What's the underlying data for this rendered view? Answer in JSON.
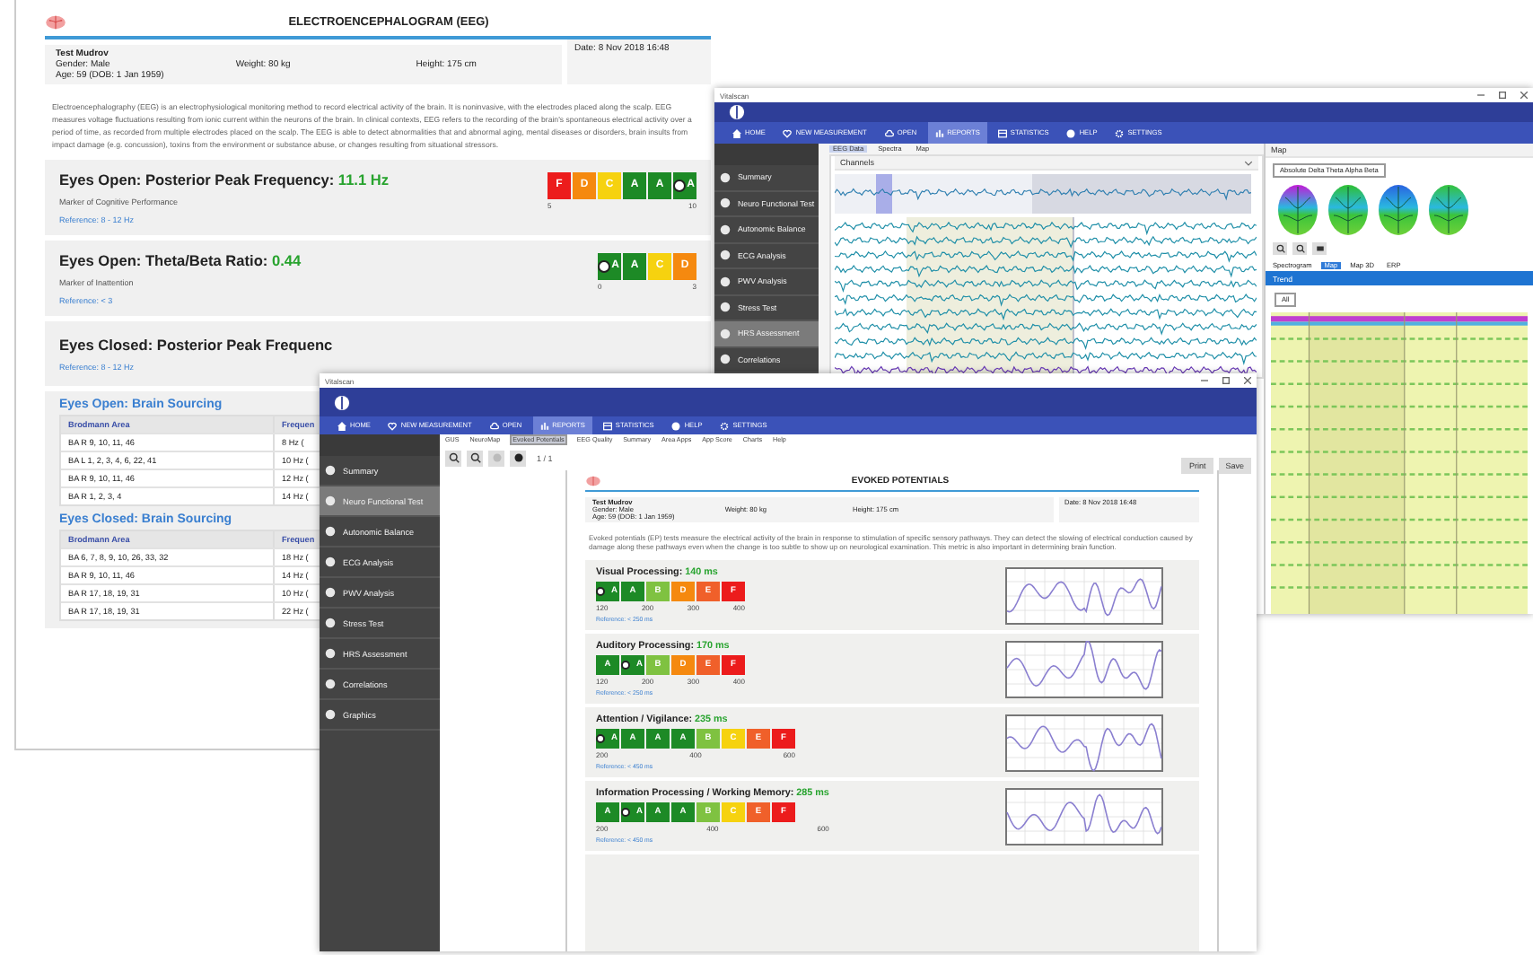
{
  "report": {
    "title": "ELECTROENCEPHALOGRAM (EEG)",
    "patient": {
      "name": "Test Mudrov",
      "gender": "Gender: Male",
      "age": "Age: 59  (DOB: 1 Jan 1959)",
      "weight": "Weight: 80 kg",
      "height": "Height: 175 cm",
      "date": "Date: 8 Nov 2018 16:48"
    },
    "description": "Electroencephalography (EEG) is an electrophysiological monitoring method to record electrical activity of the brain. It is noninvasive, with the electrodes placed along the scalp. EEG measures voltage fluctuations resulting from ionic current within the neurons of the brain. In clinical contexts, EEG refers to the recording of the brain's spontaneous electrical activity over a period of time, as recorded from multiple electrodes placed on the scalp. The EEG is able to detect abnormalities that and abnormal aging, mental diseases or disorders, brain insults from impact damage (e.g. concussion), toxins from the environment or substance abuse, or changes resulting from situational stressors.",
    "metrics": [
      {
        "title": "Eyes Open: Posterior Peak Frequency:",
        "value": "11.1 Hz",
        "marker": "Marker of Cognitive Performance",
        "reference": "Reference: 8 - 12 Hz",
        "bar": [
          {
            "grade": "F",
            "marked": false
          },
          {
            "grade": "D",
            "marked": false
          },
          {
            "grade": "C",
            "marked": false
          },
          {
            "grade": "A",
            "marked": false
          },
          {
            "grade": "A",
            "marked": false
          },
          {
            "grade": "A",
            "marked": true
          }
        ],
        "ticks": [
          "5",
          "10"
        ]
      },
      {
        "title": "Eyes Open: Theta/Beta Ratio:",
        "value": "0.44",
        "marker": "Marker of Inattention",
        "reference": "Reference: < 3",
        "bar": [
          {
            "grade": "A",
            "marked": true
          },
          {
            "grade": "A",
            "marked": false
          },
          {
            "grade": "C",
            "marked": false
          },
          {
            "grade": "D",
            "marked": false
          }
        ],
        "ticks": [
          "0",
          "3"
        ]
      }
    ],
    "closed_metric": {
      "title": "Eyes Closed: Posterior Peak Frequenc",
      "reference": "Reference: 8 - 12 Hz"
    },
    "sourcing": [
      {
        "title": "Eyes Open: Brain Sourcing",
        "columns": [
          "Brodmann Area",
          "Frequen"
        ],
        "rows": [
          [
            "BA R 9, 10, 11, 46",
            "8 Hz ("
          ],
          [
            "BA L 1, 2, 3, 4, 6, 22, 41",
            "10 Hz ("
          ],
          [
            "BA R 9, 10, 11, 46",
            "12 Hz ("
          ],
          [
            "BA R 1, 2, 3, 4",
            "14 Hz ("
          ]
        ]
      },
      {
        "title": "Eyes Closed: Brain Sourcing",
        "columns": [
          "Brodmann Area",
          "Frequen"
        ],
        "rows": [
          [
            "BA 6, 7, 8, 9, 10, 26, 33, 32",
            "18 Hz ("
          ],
          [
            "BA R 9, 10, 11, 46",
            "14 Hz ("
          ],
          [
            "BA R 17, 18, 19, 31",
            "10 Hz ("
          ],
          [
            "BA R 17, 18, 19, 31",
            "22 Hz ("
          ]
        ]
      }
    ]
  },
  "eeg_window": {
    "title": "Vitalscan",
    "nav": [
      {
        "label": "HOME",
        "selected": false
      },
      {
        "label": "NEW MEASUREMENT",
        "selected": false
      },
      {
        "label": "OPEN",
        "selected": false
      },
      {
        "label": "REPORTS",
        "selected": true
      },
      {
        "label": "STATISTICS",
        "selected": false
      },
      {
        "label": "HELP",
        "selected": false
      },
      {
        "label": "SETTINGS",
        "selected": false
      }
    ],
    "sidebar": [
      {
        "label": "Summary",
        "selected": false
      },
      {
        "label": "Neuro Functional Test",
        "selected": false
      },
      {
        "label": "Autonomic Balance",
        "selected": false
      },
      {
        "label": "ECG Analysis",
        "selected": false
      },
      {
        "label": "PWV Analysis",
        "selected": false
      },
      {
        "label": "Stress Test",
        "selected": false
      },
      {
        "label": "HRS Assessment",
        "selected": true
      },
      {
        "label": "Correlations",
        "selected": false
      }
    ],
    "tabs": [
      {
        "label": "EEG Data",
        "selected": true
      },
      {
        "label": "Spectra",
        "selected": false
      },
      {
        "label": "Map",
        "selected": false
      }
    ],
    "channels_title": "Channels",
    "map": {
      "title": "Map",
      "dropdown": "Absolute Delta Theta Alpha Beta",
      "tabs": [
        {
          "label": "Spectrogram",
          "selected": false
        },
        {
          "label": "Map",
          "selected": true
        },
        {
          "label": "Map 3D",
          "selected": false
        },
        {
          "label": "ERP",
          "selected": false
        }
      ]
    },
    "trend": {
      "title": "Trend",
      "dropdown": "All"
    }
  },
  "ep_window": {
    "title": "Vitalscan",
    "nav": [
      {
        "label": "HOME",
        "selected": false
      },
      {
        "label": "NEW MEASUREMENT",
        "selected": false
      },
      {
        "label": "OPEN",
        "selected": false
      },
      {
        "label": "REPORTS",
        "selected": true
      },
      {
        "label": "STATISTICS",
        "selected": false
      },
      {
        "label": "HELP",
        "selected": false
      },
      {
        "label": "SETTINGS",
        "selected": false
      }
    ],
    "sidebar": [
      {
        "label": "Summary",
        "selected": false
      },
      {
        "label": "Neuro Functional Test",
        "selected": true
      },
      {
        "label": "Autonomic Balance",
        "selected": false
      },
      {
        "label": "ECG Analysis",
        "selected": false
      },
      {
        "label": "PWV Analysis",
        "selected": false
      },
      {
        "label": "Stress Test",
        "selected": false
      },
      {
        "label": "HRS Assessment",
        "selected": false
      },
      {
        "label": "Correlations",
        "selected": false
      },
      {
        "label": "Graphics",
        "selected": false
      }
    ],
    "report_tabs": [
      {
        "label": "GUS",
        "selected": false
      },
      {
        "label": "NeuroMap",
        "selected": false
      },
      {
        "label": "Evoked Potentials",
        "selected": true
      },
      {
        "label": "EEG Quality",
        "selected": false
      },
      {
        "label": "Summary",
        "selected": false
      },
      {
        "label": "Area Apps",
        "selected": false
      },
      {
        "label": "App Score",
        "selected": false
      },
      {
        "label": "Charts",
        "selected": false
      },
      {
        "label": "Help",
        "selected": false
      }
    ],
    "page": "1 / 1",
    "buttons": [
      "Print",
      "Save"
    ],
    "document": {
      "title": "EVOKED POTENTIALS",
      "patient": {
        "name": "Test Mudrov",
        "gender": "Gender: Male",
        "age": "Age: 59  (DOB: 1 Jan 1959)",
        "weight": "Weight: 80 kg",
        "height": "Height: 175 cm",
        "date": "Date: 8 Nov 2018 16:48"
      },
      "description": "Evoked potentials (EP) tests measure the electrical activity of the brain in response to stimulation of specific sensory pathways. They can detect the slowing of electrical conduction caused by damage along these pathways even when the change is too subtle to show up on neurological examination. This metric is also important in determining brain function.",
      "tests": [
        {
          "title": "Visual Processing:",
          "value": "140 ms",
          "bar": [
            {
              "grade": "A",
              "marked": true
            },
            {
              "grade": "A",
              "marked": false
            },
            {
              "grade": "B",
              "marked": false
            },
            {
              "grade": "D",
              "marked": false
            },
            {
              "grade": "E",
              "marked": false
            },
            {
              "grade": "F",
              "marked": false
            }
          ],
          "ticks": [
            "120",
            "200",
            "300",
            "400"
          ],
          "reference": "Reference: < 250 ms"
        },
        {
          "title": "Auditory Processing:",
          "value": "170 ms",
          "bar": [
            {
              "grade": "A",
              "marked": false
            },
            {
              "grade": "A",
              "marked": true
            },
            {
              "grade": "B",
              "marked": false
            },
            {
              "grade": "D",
              "marked": false
            },
            {
              "grade": "E",
              "marked": false
            },
            {
              "grade": "F",
              "marked": false
            }
          ],
          "ticks": [
            "120",
            "200",
            "300",
            "400"
          ],
          "reference": "Reference: < 250 ms"
        },
        {
          "title": "Attention / Vigilance:",
          "value": "235 ms",
          "bar": [
            {
              "grade": "A",
              "marked": true
            },
            {
              "grade": "A",
              "marked": false
            },
            {
              "grade": "A",
              "marked": false
            },
            {
              "grade": "A",
              "marked": false
            },
            {
              "grade": "B",
              "marked": false
            },
            {
              "grade": "C",
              "marked": false
            },
            {
              "grade": "E",
              "marked": false
            },
            {
              "grade": "F",
              "marked": false
            }
          ],
          "ticks": [
            "200",
            "400",
            "600"
          ],
          "reference": "Reference: < 450 ms"
        },
        {
          "title": "Information Processing / Working Memory:",
          "value": "285 ms",
          "bar": [
            {
              "grade": "A",
              "marked": false
            },
            {
              "grade": "A",
              "marked": true
            },
            {
              "grade": "A",
              "marked": false
            },
            {
              "grade": "A",
              "marked": false
            },
            {
              "grade": "B",
              "marked": false
            },
            {
              "grade": "C",
              "marked": false
            },
            {
              "grade": "E",
              "marked": false
            },
            {
              "grade": "F",
              "marked": false
            }
          ],
          "ticks": [
            "200",
            "400",
            "600"
          ],
          "reference": "Reference: < 450 ms"
        }
      ]
    }
  }
}
